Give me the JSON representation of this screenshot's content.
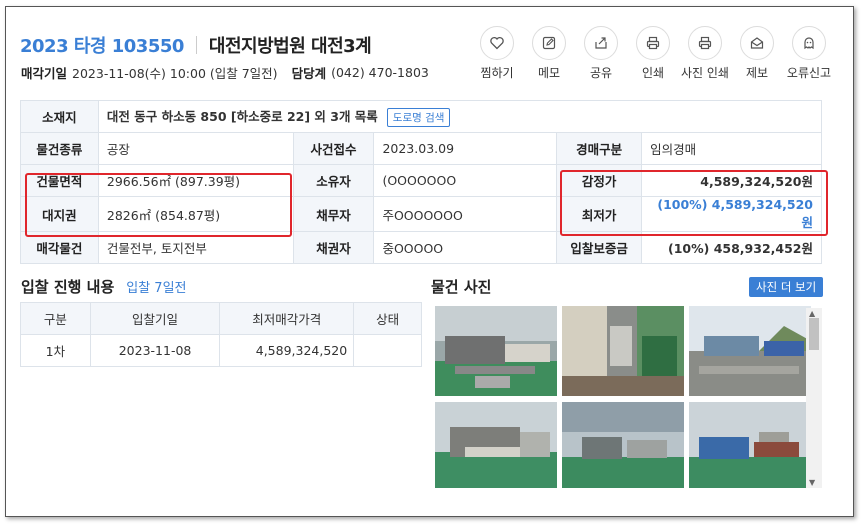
{
  "header": {
    "case_no": "2023 타경 103550",
    "court": "대전지방법원 대전3계",
    "sale_date_label": "매각기일",
    "sale_date_value": "2023-11-08(수) 10:00 (입찰 7일전)",
    "dept_label": "담당계",
    "dept_value": "(042) 470-1803"
  },
  "actions": [
    {
      "label": "찜하기",
      "icon": "heart-icon"
    },
    {
      "label": "메모",
      "icon": "pencil-icon"
    },
    {
      "label": "공유",
      "icon": "share-icon"
    },
    {
      "label": "인쇄",
      "icon": "printer-icon"
    },
    {
      "label": "사진 인쇄",
      "icon": "printer-icon"
    },
    {
      "label": "제보",
      "icon": "envelope-icon"
    },
    {
      "label": "오류신고",
      "icon": "ghost-icon"
    }
  ],
  "info": {
    "location_label": "소재지",
    "location_value": "대전 동구 하소동 850 [하소중로 22] 외 3개 목록",
    "road_search": "도로명 검색",
    "type_label": "물건종류",
    "type_value": "공장",
    "received_label": "사건접수",
    "received_value": "2023.03.09",
    "auction_kind_label": "경매구분",
    "auction_kind_value": "임의경매",
    "building_area_label": "건물면적",
    "building_area_value": "2966.56㎡ (897.39평)",
    "owner_label": "소유자",
    "owner_value": "(OOOOOOO",
    "appraisal_label": "감정가",
    "appraisal_value": "4,589,324,520원",
    "land_right_label": "대지권",
    "land_right_value": "2826㎡ (854.87평)",
    "debtor_label": "채무자",
    "debtor_value": "주OOOOOOO",
    "minimum_label": "최저가",
    "minimum_value": "(100%) 4,589,324,520원",
    "sale_object_label": "매각물건",
    "sale_object_value": "건물전부, 토지전부",
    "creditor_label": "채권자",
    "creditor_value": "중OOOOO",
    "deposit_label": "입찰보증금",
    "deposit_value": "(10%) 458,932,452원"
  },
  "bid": {
    "title": "입찰 진행 내용",
    "subtitle": "입찰 7일전",
    "columns": [
      "구분",
      "입찰기일",
      "최저매각가격",
      "상태"
    ],
    "rows": [
      {
        "round": "1차",
        "date": "2023-11-08",
        "price": "4,589,324,520",
        "status": ""
      }
    ]
  },
  "photos": {
    "title": "물건 사진",
    "more_button": "사진 더 보기"
  },
  "colors": {
    "accent": "#3a7fd5",
    "highlight_box": "#e0262c",
    "header_cell": "#f3f6fa"
  }
}
